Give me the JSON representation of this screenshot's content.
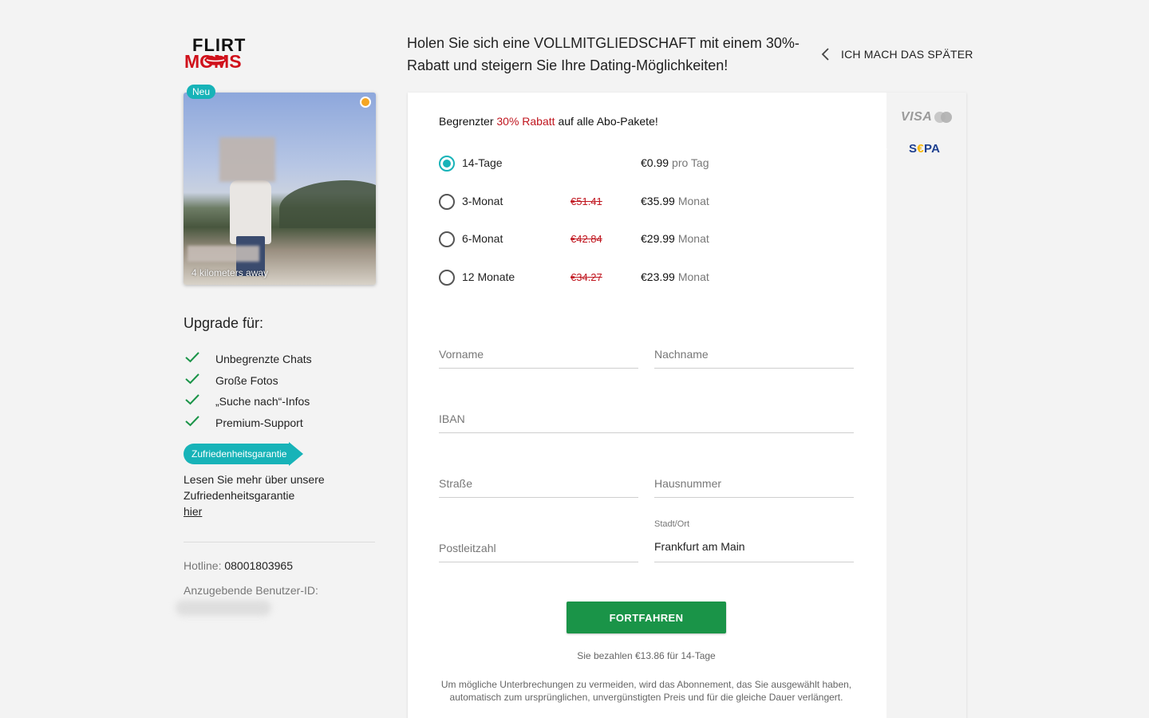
{
  "logo": {
    "line1": "FLIRT",
    "line2": "MOMS"
  },
  "profile": {
    "badge": "Neu",
    "distance": "4 kilometers away"
  },
  "upgrade": {
    "title": "Upgrade für:",
    "features": [
      "Unbegrenzte Chats",
      "Große Fotos",
      "„Suche nach“-Infos",
      "Premium-Support"
    ],
    "guarantee_badge": "Zufriedenheitsgarantie",
    "more_text": "Lesen Sie mehr über unsere Zufriedenheitsgarantie",
    "more_link": "hier"
  },
  "contact": {
    "hotline_label": "Hotline:",
    "hotline_number": "08001803965",
    "userid_label": "Anzugebende Benutzer-ID:"
  },
  "header": {
    "headline": "Holen Sie sich eine VOLLMITGLIEDSCHAFT mit einem 30%-Rabatt und steigern Sie Ihre Dating-Möglichkeiten!",
    "later": "ICH MACH DAS SPÄTER"
  },
  "promo": {
    "prefix": "Begrenzter",
    "highlight": "30% Rabatt",
    "suffix": "auf alle Abo-Pakete!"
  },
  "plans": [
    {
      "name": "14-Tage",
      "old_price": "",
      "price": "€0.99",
      "unit": "pro Tag",
      "selected": true
    },
    {
      "name": "3-Monat",
      "old_price": "€51.41",
      "price": "€35.99",
      "unit": "Monat",
      "selected": false
    },
    {
      "name": "6-Monat",
      "old_price": "€42.84",
      "price": "€29.99",
      "unit": "Monat",
      "selected": false
    },
    {
      "name": "12 Monate",
      "old_price": "€34.27",
      "price": "€23.99",
      "unit": "Monat",
      "selected": false
    }
  ],
  "form": {
    "first_name": "Vorname",
    "last_name": "Nachname",
    "iban": "IBAN",
    "street": "Straße",
    "house_number": "Hausnummer",
    "zip": "Postleitzahl",
    "city_label": "Stadt/Ort",
    "city_value": "Frankfurt am Main"
  },
  "payment_methods": {
    "visa": "VISA",
    "sepa_s": "S",
    "sepa_e": "€",
    "sepa_pa": "PA"
  },
  "submit": "FORTFAHREN",
  "pay_info": "Sie bezahlen  €13.86 für 14-Tage",
  "renewal_note": "Um mögliche Unterbrechungen zu vermeiden, wird das Abonnement, das Sie ausgewählt haben, automatisch zum ursprünglichen, unvergünstigten Preis und für die gleiche Dauer verlängert.",
  "colors": {
    "accent": "#17b3b8",
    "button": "#1a9448",
    "discount": "#c0161f",
    "online": "#f5a623"
  }
}
